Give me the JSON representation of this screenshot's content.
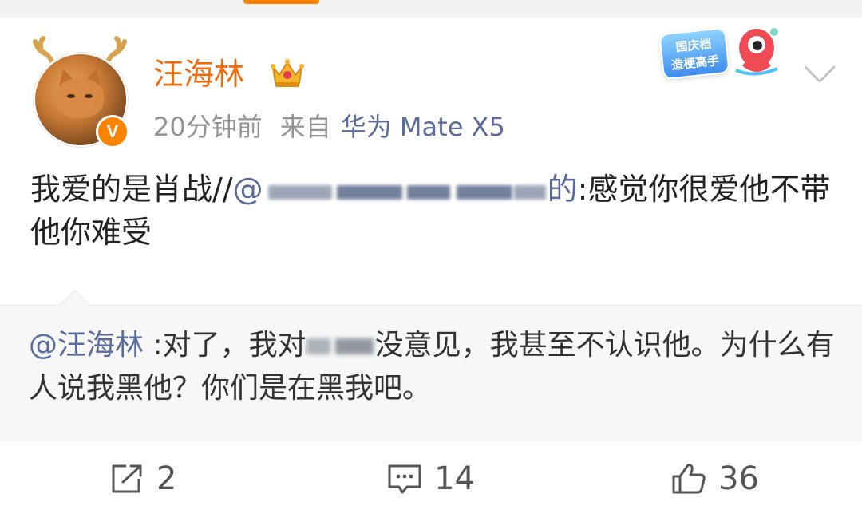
{
  "header": {
    "username": "汪海林",
    "time_ago": "20分钟前",
    "source_prefix": "来自",
    "device": "华为 Mate X5"
  },
  "badges": {
    "verified": "V",
    "sticker_line1": "国庆档",
    "sticker_line2": "造梗高手"
  },
  "post": {
    "text_before_mention": "我爱的是肖战//",
    "mention_prefix": "@",
    "mention_visible_suffix": "的",
    "text_after_mention": ":感觉你很爱他不带他你难受"
  },
  "retweet": {
    "mention": "@汪海林",
    "text_part1": " :对了，我对",
    "text_part2": "没意见，我甚至不认识他。为什么有人说我黑他？你们是在黑我吧。"
  },
  "actions": {
    "reposts": "2",
    "comments": "14",
    "likes": "36"
  },
  "colors": {
    "username": "#f06a0e",
    "link": "#5a6b9c",
    "meta": "#939393",
    "verified_badge": "#ff8200"
  },
  "icons": [
    "antler-icon",
    "verified-badge-icon",
    "crown-icon",
    "sticker-mascot-icon",
    "chevron-down-icon",
    "repost-icon",
    "comment-icon",
    "like-icon"
  ]
}
